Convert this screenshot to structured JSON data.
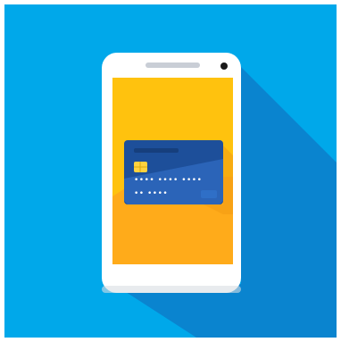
{
  "card": {
    "number_masked": "•••• •••• ••••",
    "expiry_masked": "•• ••••"
  },
  "colors": {
    "background": "#00a8ea",
    "shadow": "#0a84cf",
    "phone_body": "#ffffff",
    "screen_top": "#ffc20e",
    "screen_bottom": "#ffab1a",
    "card_dark": "#1d4f9a",
    "card_light": "#2b64b8",
    "chip": "#ffd23f"
  },
  "icons": {
    "speaker": "speaker-grille-icon",
    "camera": "front-camera-icon",
    "chip": "emv-chip-icon"
  }
}
